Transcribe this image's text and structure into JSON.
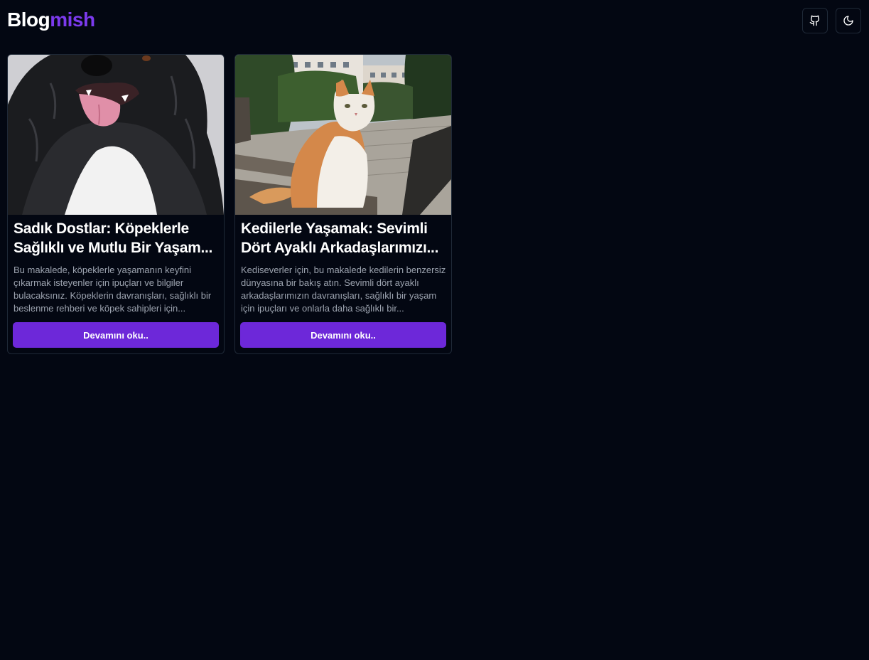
{
  "header": {
    "logo_part1": "Blog",
    "logo_part2": "mish",
    "github_icon": "github-icon",
    "theme_icon": "moon-icon"
  },
  "colors": {
    "background": "#030712",
    "accent": "#7c3aed",
    "button": "#6d28d9",
    "muted_text": "#9ca3af",
    "border": "#1f2937"
  },
  "posts": [
    {
      "image": "dog-photo",
      "title": "Sadık Dostlar: Köpeklerle Sağlıklı ve Mutlu Bir Yaşam...",
      "description": "Bu makalede, köpeklerle yaşamanın keyfini çıkarmak isteyenler için ipuçları ve bilgiler bulacaksınız. Köpeklerin davranışları, sağlıklı bir beslenme rehberi ve köpek sahipleri için...",
      "button_label": "Devamını oku.."
    },
    {
      "image": "cat-photo",
      "title": "Kedilerle Yaşamak: Sevimli Dört Ayaklı Arkadaşlarımızı...",
      "description": "Kediseverler için, bu makalede kedilerin benzersiz dünyasına bir bakış atın. Sevimli dört ayaklı arkadaşlarımızın davranışları, sağlıklı bir yaşam için ipuçları ve onlarla daha sağlıklı bir...",
      "button_label": "Devamını oku.."
    }
  ]
}
